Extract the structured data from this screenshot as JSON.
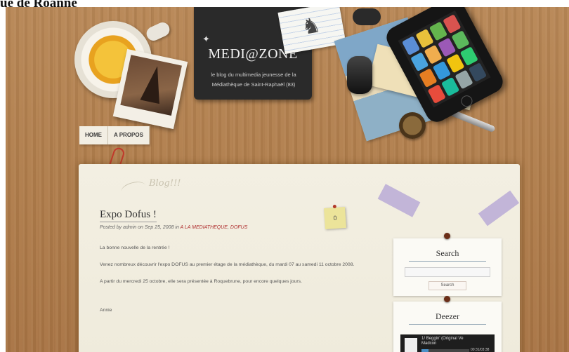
{
  "caption": "ue de Roanne",
  "header": {
    "site_title": "MEDI@ZONE",
    "tagline": "le blog du multimedia jeunesse de la Médiathèque de Saint-Raphaël (83)"
  },
  "nav": {
    "items": [
      {
        "label": "HOME"
      },
      {
        "label": "A PROPOS"
      }
    ]
  },
  "main": {
    "blog_tag": "Blog!!!",
    "post": {
      "title": "Expo Dofus !",
      "meta_prefix": "Posted by admin on Sep 25, 2008 in",
      "categories": [
        "A LA MEDIATHEQUE",
        "DOFUS"
      ],
      "comment_count": "0",
      "paragraphs": [
        "La bonne nouvelle de la rentrée !",
        "Venez nombreux découvrir l'expo DOFUS au premier étage de la médiathèque, du mardi 07 au samedi 11 octobre 2008.",
        "A partir du mercredi 25 octobre, elle sera présentée à Roquebrune, pour encore quelques jours.",
        "Annie"
      ]
    }
  },
  "sidebar": {
    "search": {
      "title": "Search",
      "input_value": "",
      "button_label": "Search"
    },
    "deezer": {
      "title": "Deezer",
      "track_line1": "1/",
      "track_line2": "Beggin' (Original Ve",
      "track_artist": "Madcon",
      "time": "00:31/03:38",
      "progress": 0.14
    }
  },
  "colors": {
    "link": "#b03030",
    "wood": "#b07d4b",
    "paper": "#f3efe2"
  }
}
